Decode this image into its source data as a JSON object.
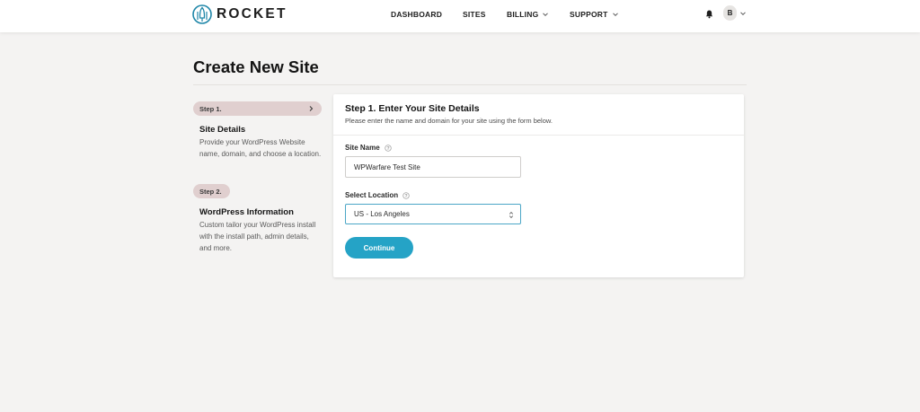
{
  "header": {
    "brand": "ROCKET",
    "nav": [
      {
        "label": "DASHBOARD",
        "icon": ""
      },
      {
        "label": "SITES",
        "icon": ""
      },
      {
        "label": "BILLING",
        "icon": "chevron-down-icon"
      },
      {
        "label": "SUPPORT",
        "icon": "chevron-down-icon"
      }
    ],
    "avatar_initial": "B"
  },
  "page": {
    "title": "Create New Site"
  },
  "steps": [
    {
      "badge": "Step 1.",
      "title": "Site Details",
      "description": "Provide your WordPress Website name, domain, and choose a location.",
      "active": true
    },
    {
      "badge": "Step 2.",
      "title": "WordPress Information",
      "description": "Custom tailor your WordPress install with the install path, admin details, and more.",
      "active": false
    }
  ],
  "form": {
    "title": "Step 1. Enter Your Site Details",
    "subtitle": "Please enter the name and domain for your site using the form below.",
    "site_name_label": "Site Name",
    "site_name_value": "WPWarfare Test Site",
    "location_label": "Select Location",
    "location_value": "US - Los Angeles",
    "submit_label": "Continue"
  },
  "colors": {
    "accent": "#25a3c6",
    "step_pill": "#e0cfcf",
    "background": "#f4f3f2"
  }
}
